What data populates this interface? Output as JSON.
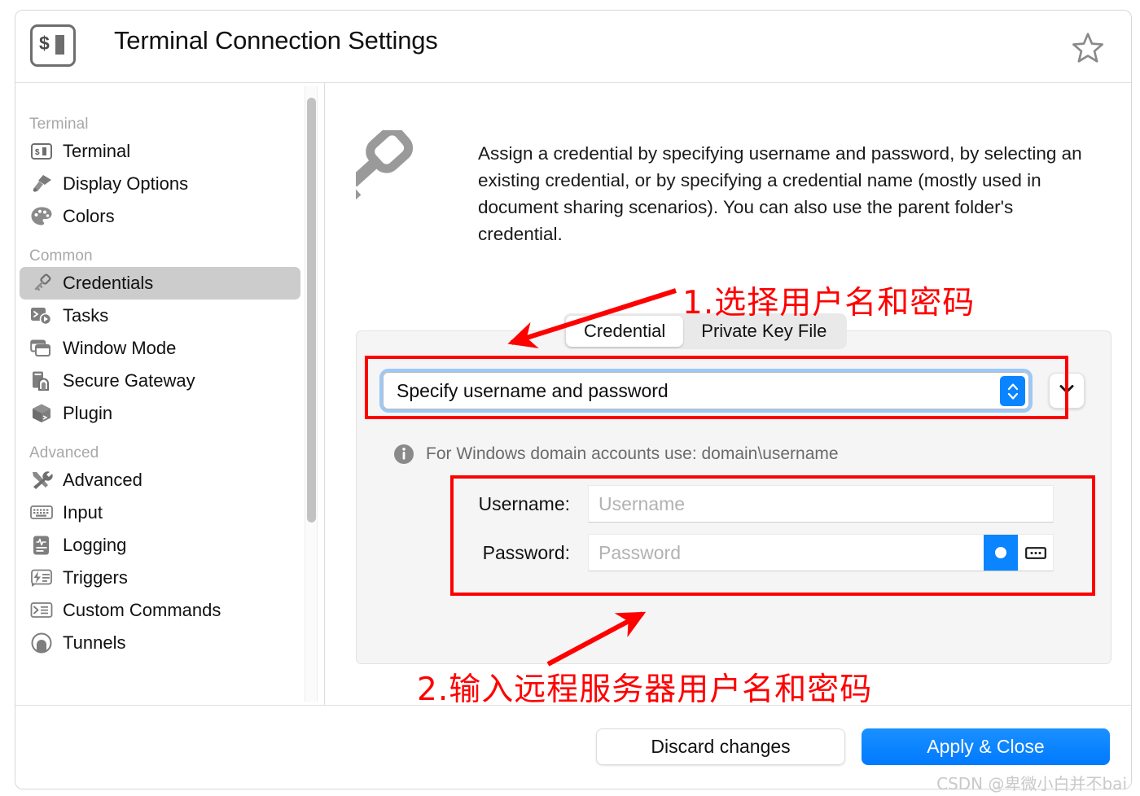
{
  "window": {
    "title": "Terminal Connection Settings",
    "app_icon": "terminal-icon",
    "favorite_icon": "star-outline-icon"
  },
  "sidebar": {
    "groups": [
      {
        "label": "Terminal",
        "items": [
          {
            "label": "Terminal",
            "icon": "terminal-icon",
            "selected": false
          },
          {
            "label": "Display Options",
            "icon": "paintbrush-icon",
            "selected": false
          },
          {
            "label": "Colors",
            "icon": "palette-icon",
            "selected": false
          }
        ]
      },
      {
        "label": "Common",
        "items": [
          {
            "label": "Credentials",
            "icon": "key-icon",
            "selected": true
          },
          {
            "label": "Tasks",
            "icon": "tasks-icon",
            "selected": false
          },
          {
            "label": "Window Mode",
            "icon": "window-icon",
            "selected": false
          },
          {
            "label": "Secure Gateway",
            "icon": "gateway-icon",
            "selected": false
          },
          {
            "label": "Plugin",
            "icon": "cube-icon",
            "selected": false
          }
        ]
      },
      {
        "label": "Advanced",
        "items": [
          {
            "label": "Advanced",
            "icon": "tools-icon",
            "selected": false
          },
          {
            "label": "Input",
            "icon": "keyboard-icon",
            "selected": false
          },
          {
            "label": "Logging",
            "icon": "logging-icon",
            "selected": false
          },
          {
            "label": "Triggers",
            "icon": "triggers-icon",
            "selected": false
          },
          {
            "label": "Custom Commands",
            "icon": "command-prompt-icon",
            "selected": false
          },
          {
            "label": "Tunnels",
            "icon": "tunnel-icon",
            "selected": false
          }
        ]
      }
    ]
  },
  "main": {
    "description": "Assign a credential by specifying username and password, by selecting an existing credential, or by specifying a credential name (mostly used in document sharing scenarios). You can also use the parent folder's credential.",
    "description_icon": "key-icon",
    "tabs": [
      {
        "label": "Credential",
        "active": true
      },
      {
        "label": "Private Key File",
        "active": false
      }
    ],
    "credential_select": {
      "value": "Specify username and password",
      "stepper_icon": "stepper-up-down-icon",
      "dropdown_icon": "chevron-down-icon"
    },
    "info_hint": {
      "icon": "info-icon",
      "text": "For Windows domain accounts use: domain\\username"
    },
    "fields": [
      {
        "label": "Username:",
        "placeholder": "Username",
        "value": "",
        "name": "username-field"
      },
      {
        "label": "Password:",
        "placeholder": "Password",
        "value": "",
        "name": "password-field",
        "reveal_icon": "password-reveal-dot-icon",
        "keyboard_icon": "password-keyboard-icon"
      }
    ]
  },
  "footer": {
    "discard_label": "Discard changes",
    "apply_label": "Apply & Close"
  },
  "annotations": {
    "step1": "1.选择用户名和密码",
    "step2": "2.输入远程服务器用户名和密码"
  },
  "watermark": "CSDN @卑微小白并不bai",
  "colors": {
    "accent_blue": "#007aff",
    "annotation_red": "#ff0000",
    "sidebar_selected": "#cccccc",
    "panel_bg": "#f5f5f5"
  }
}
